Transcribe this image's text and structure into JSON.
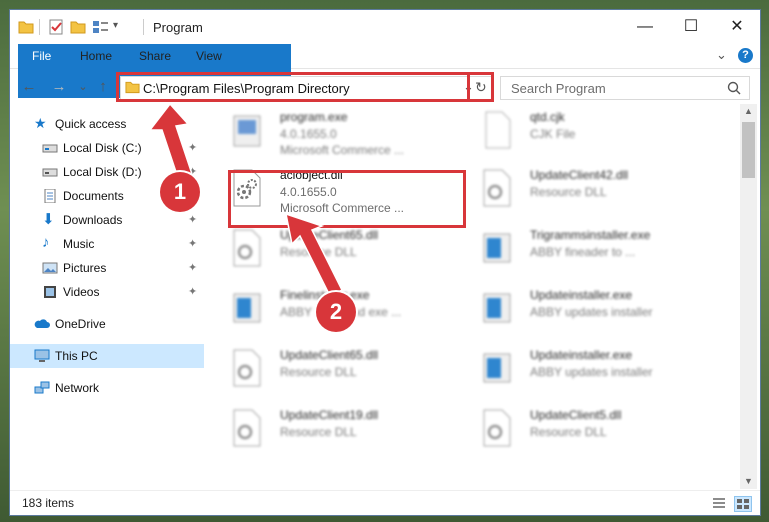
{
  "window": {
    "title": "Program",
    "controls": {
      "minimize": "—",
      "maximize": "☐",
      "close": "✕"
    }
  },
  "ribbon": {
    "tabs": [
      {
        "label": "File"
      },
      {
        "label": "Home"
      },
      {
        "label": "Share"
      },
      {
        "label": "View"
      }
    ],
    "expand": "⌄",
    "help": "?"
  },
  "address": {
    "path": "C:\\Program Files\\Program Directory",
    "dropdown": "⌄",
    "refresh": "↻"
  },
  "search": {
    "placeholder": "Search Program"
  },
  "nav": {
    "back": "←",
    "forward": "→",
    "recent": "⌄",
    "up": "↑",
    "items": [
      {
        "label": "Quick access",
        "icon": "star-icon"
      },
      {
        "label": "Local Disk (C:)",
        "icon": "drive-icon",
        "pin": "📌"
      },
      {
        "label": "Local Disk (D:)",
        "icon": "drive-icon",
        "pin": "📌"
      },
      {
        "label": "Documents",
        "icon": "documents-icon",
        "pin": "📌"
      },
      {
        "label": "Downloads",
        "icon": "download-icon",
        "pin": "📌"
      },
      {
        "label": "Music",
        "icon": "music-icon",
        "pin": "📌"
      },
      {
        "label": "Pictures",
        "icon": "pictures-icon",
        "pin": "📌"
      },
      {
        "label": "Videos",
        "icon": "videos-icon",
        "pin": "📌"
      },
      {
        "label": "OneDrive",
        "icon": "cloud-icon"
      },
      {
        "label": "This PC",
        "icon": "computer-icon"
      },
      {
        "label": "Network",
        "icon": "network-icon"
      }
    ]
  },
  "files": [
    {
      "name": "program.exe",
      "meta1": "4.0.1655.0",
      "meta2": "Microsoft Commerce ...",
      "icon": "exe-icon"
    },
    {
      "name": "qtd.cjk",
      "meta1": "CJK File",
      "meta2": "",
      "icon": "blank-file-icon"
    },
    {
      "name": "aclobject.dll",
      "meta1": "4.0.1655.0",
      "meta2": "Microsoft Commerce ...",
      "icon": "dll-gear-icon"
    },
    {
      "name": "UpdateClient42.dll",
      "meta1": "Resource DLL",
      "meta2": "",
      "icon": "dll-gear-icon"
    },
    {
      "name": "UpdateClient65.dll",
      "meta1": "Resource DLL",
      "meta2": "",
      "icon": "dll-gear-icon"
    },
    {
      "name": "Trigrammsinstaller.exe",
      "meta1": "ABBY fineader to ...",
      "meta2": "",
      "icon": "installer-icon"
    },
    {
      "name": "Finelinstaller.exe",
      "meta1": "ABBY fineround exe ...",
      "meta2": "",
      "icon": "installer-icon"
    },
    {
      "name": "Updateinstaller.exe",
      "meta1": "ABBY updates installer",
      "meta2": "",
      "icon": "installer-icon"
    },
    {
      "name": "UpdateClient65.dll",
      "meta1": "Resource DLL",
      "meta2": "",
      "icon": "dll-gear-icon"
    },
    {
      "name": "Updateinstaller.exe",
      "meta1": "ABBY updates installer",
      "meta2": "",
      "icon": "installer-icon"
    },
    {
      "name": "UpdateClient19.dll",
      "meta1": "Resource DLL",
      "meta2": "",
      "icon": "dll-gear-icon"
    },
    {
      "name": "UpdateClient5.dll",
      "meta1": "Resource DLL",
      "meta2": "",
      "icon": "dll-gear-icon"
    }
  ],
  "status": {
    "item_count": "183 items"
  },
  "callouts": {
    "one": "1",
    "two": "2"
  },
  "colors": {
    "accent": "#1979ca",
    "highlight": "#d8363a",
    "selected": "#cce8ff"
  }
}
